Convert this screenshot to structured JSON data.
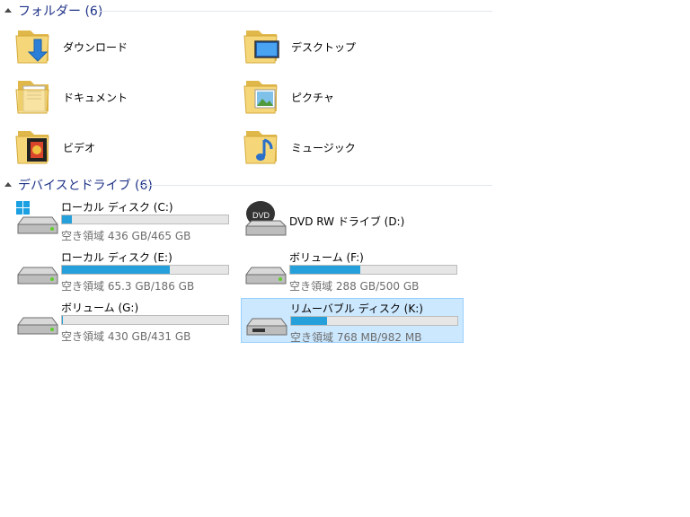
{
  "folders_group": {
    "title": "フォルダー (6)"
  },
  "folders": [
    {
      "label": "ダウンロード",
      "icon": "download-folder-icon"
    },
    {
      "label": "デスクトップ",
      "icon": "desktop-folder-icon"
    },
    {
      "label": "ドキュメント",
      "icon": "documents-folder-icon"
    },
    {
      "label": "ピクチャ",
      "icon": "pictures-folder-icon"
    },
    {
      "label": "ビデオ",
      "icon": "videos-folder-icon"
    },
    {
      "label": "ミュージック",
      "icon": "music-folder-icon"
    }
  ],
  "drives_group": {
    "title": "デバイスとドライブ (6)"
  },
  "drives": [
    {
      "name": "ローカル ディスク (C:)",
      "free_text": "空き領域 436 GB/465 GB",
      "used_fraction": 0.062,
      "icon": "system-drive-icon"
    },
    {
      "name": "DVD RW ドライブ (D:)",
      "free_text": "",
      "used_fraction": null,
      "icon": "dvd-drive-icon"
    },
    {
      "name": "ローカル ディスク (E:)",
      "free_text": "空き領域 65.3 GB/186 GB",
      "used_fraction": 0.649,
      "icon": "hard-drive-icon"
    },
    {
      "name": "ボリューム (F:)",
      "free_text": "空き領域 288 GB/500 GB",
      "used_fraction": 0.424,
      "icon": "hard-drive-icon"
    },
    {
      "name": "ボリューム (G:)",
      "free_text": "空き領域 430 GB/431 GB",
      "used_fraction": 0.002,
      "icon": "hard-drive-icon"
    },
    {
      "name": "リムーバブル ディスク (K:)",
      "free_text": "空き領域 768 MB/982 MB",
      "used_fraction": 0.218,
      "icon": "removable-drive-icon",
      "selected": true
    }
  ],
  "colors": {
    "bar_fill": "#26a0da",
    "group_title": "#1e3287",
    "selection": "#cce8ff"
  }
}
